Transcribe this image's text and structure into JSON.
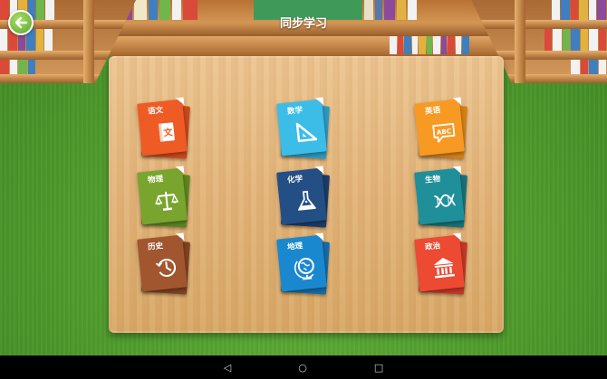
{
  "header": {
    "title": "同步学习"
  },
  "subjects": [
    {
      "label": "语文",
      "color": "#ef5b25",
      "shade": "#c9471c",
      "icon": "chinese-book-icon",
      "icon_text": "文"
    },
    {
      "label": "数学",
      "color": "#3bbde8",
      "shade": "#2a99c2",
      "icon": "set-square-icon"
    },
    {
      "label": "英语",
      "color": "#f79a24",
      "shade": "#d67f14",
      "icon": "abc-bubble-icon",
      "icon_text": "ABC"
    },
    {
      "label": "物理",
      "color": "#79a52e",
      "shade": "#5d8520",
      "icon": "balance-scale-icon"
    },
    {
      "label": "化学",
      "color": "#244f85",
      "shade": "#1a3c68",
      "icon": "flask-icon"
    },
    {
      "label": "生物",
      "color": "#1f8f9a",
      "shade": "#17717a",
      "icon": "dna-icon"
    },
    {
      "label": "历史",
      "color": "#a1562f",
      "shade": "#7e4122",
      "icon": "history-clock-icon"
    },
    {
      "label": "地理",
      "color": "#1a88cf",
      "shade": "#146ca6",
      "icon": "globe-icon"
    },
    {
      "label": "政治",
      "color": "#ec4a33",
      "shade": "#c43726",
      "icon": "government-building-icon"
    }
  ],
  "navbar": {
    "back": "◁",
    "home": "○",
    "recents": "□"
  }
}
